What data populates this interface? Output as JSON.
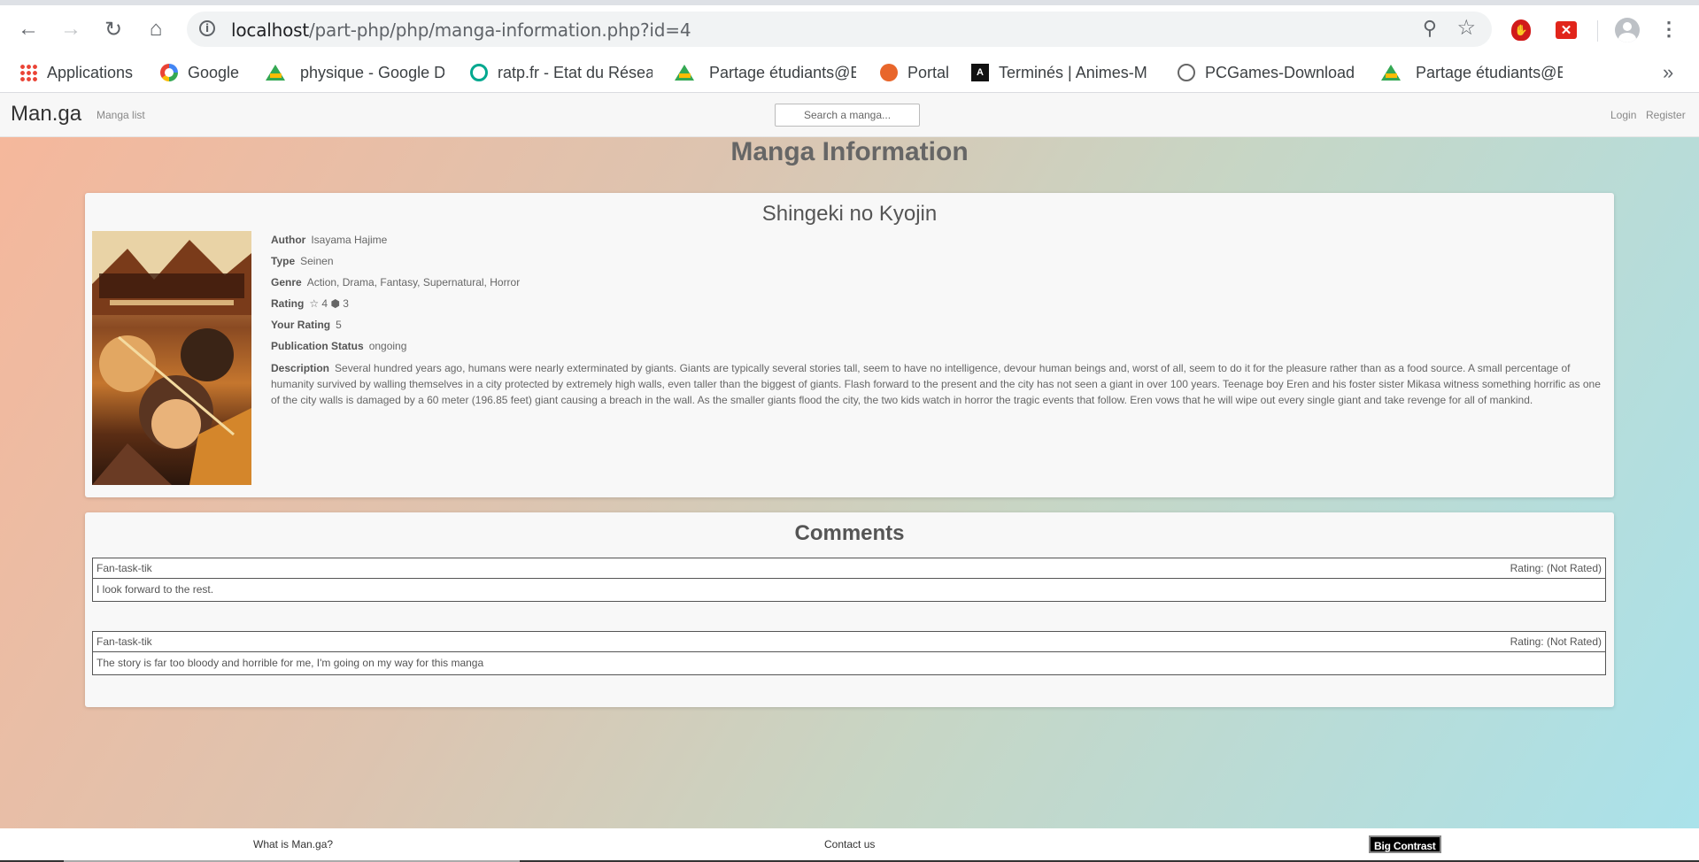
{
  "browser": {
    "url_host": "localhost",
    "url_path": "/part-php/php/manga-information.php?id=4",
    "bookmarks": [
      {
        "label": "Applications",
        "icon": "apps-grid-icon"
      },
      {
        "label": "Google",
        "icon": "google-icon"
      },
      {
        "label": "physique - Google Dr",
        "icon": "google-drive-icon"
      },
      {
        "label": "ratp.fr - Etat du Résea",
        "icon": "ratp-icon"
      },
      {
        "label": "Partage étudiants@EI",
        "icon": "google-drive-icon"
      },
      {
        "label": "Portal",
        "icon": "portal-icon"
      },
      {
        "label": "Terminés | Animes-M",
        "icon": "animes-icon"
      },
      {
        "label": "PCGames-Download",
        "icon": "steam-icon"
      },
      {
        "label": "Partage étudiants@EI",
        "icon": "google-drive-icon"
      }
    ],
    "more_bookmarks": "»"
  },
  "site": {
    "brand": "Man.ga",
    "nav_manga_list": "Manga list",
    "search_placeholder": "Search a manga...",
    "login": "Login",
    "register": "Register"
  },
  "page": {
    "title": "Manga Information"
  },
  "manga": {
    "title": "Shingeki no Kyojin",
    "author_label": "Author",
    "author": "Isayama Hajime",
    "type_label": "Type",
    "type": "Seinen",
    "genre_label": "Genre",
    "genre": "Action, Drama, Fantasy, Supernatural, Horror",
    "rating_label": "Rating",
    "rating": "☆ 4 ⬢ 3",
    "your_rating_label": "Your Rating",
    "your_rating": "5",
    "status_label": "Publication Status",
    "status": "ongoing",
    "description_label": "Description",
    "description": "Several hundred years ago, humans were nearly exterminated by giants. Giants are typically several stories tall, seem to have no intelligence, devour human beings and, worst of all, seem to do it for the pleasure rather than as a food source. A small percentage of humanity survived by walling themselves in a city protected by extremely high walls, even taller than the biggest of giants. Flash forward to the present and the city has not seen a giant in over 100 years. Teenage boy Eren and his foster sister Mikasa witness something horrific as one of the city walls is damaged by a 60 meter (196.85 feet) giant causing a breach in the wall. As the smaller giants flood the city, the two kids watch in horror the tragic events that follow. Eren vows that he will wipe out every single giant and take revenge for all of mankind."
  },
  "comments": {
    "title": "Comments",
    "items": [
      {
        "author": "Fan-task-tik",
        "rating": "Rating: (Not Rated)",
        "text": "I look forward to the rest."
      },
      {
        "author": "Fan-task-tik",
        "rating": "Rating: (Not Rated)",
        "text": "The story is far too bloody and horrible for me, I'm going on my way for this manga"
      }
    ]
  },
  "footer": {
    "what_is": "What is Man.ga?",
    "contact": "Contact us",
    "big_contrast": "Big Contrast"
  }
}
